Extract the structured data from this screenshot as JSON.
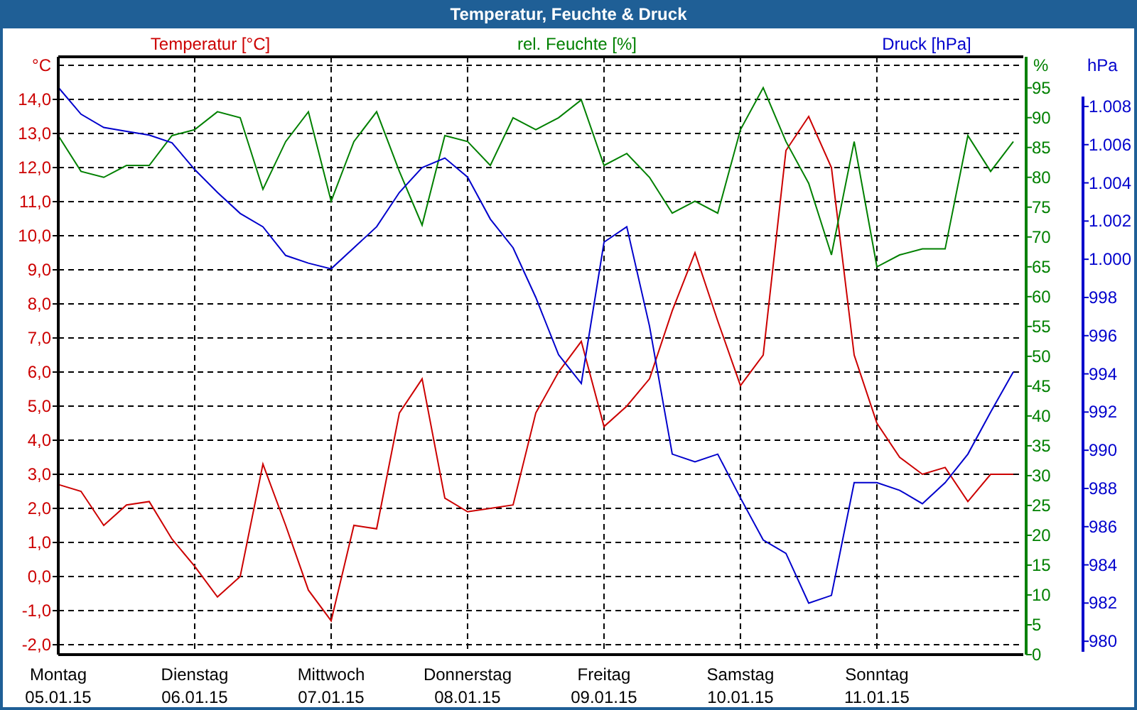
{
  "window": {
    "title": "Temperatur, Feuchte & Druck"
  },
  "chart": {
    "chart_data": {
      "type": "line",
      "grid": true,
      "categories": [
        "Montag 05.01.15",
        null,
        null,
        null,
        null,
        null,
        "Dienstag 06.01.15",
        null,
        null,
        null,
        null,
        null,
        "Mittwoch 07.01.15",
        null,
        null,
        null,
        null,
        null,
        "Donnerstag 08.01.15",
        null,
        null,
        null,
        null,
        null,
        "Freitag 09.01.15",
        null,
        null,
        null,
        null,
        null,
        "Samstag 10.01.15",
        null,
        null,
        null,
        null,
        null,
        "Sonntag 11.01.15",
        null,
        null,
        null,
        null,
        null,
        null
      ],
      "ylabel": "°C",
      "ylim": [
        -2.29,
        15.25
      ],
      "yticks": [
        {
          "value": -2,
          "label": "-2,0"
        },
        {
          "value": -1,
          "label": "-1,0"
        },
        {
          "value": 0,
          "label": "0,0"
        },
        {
          "value": 1,
          "label": "1,0"
        },
        {
          "value": 2,
          "label": "2,0"
        },
        {
          "value": 3,
          "label": "3,0"
        },
        {
          "value": 4,
          "label": "4,0"
        },
        {
          "value": 5,
          "label": "5,0"
        },
        {
          "value": 6,
          "label": "6,0"
        },
        {
          "value": 7,
          "label": "7,0"
        },
        {
          "value": 8,
          "label": "8,0"
        },
        {
          "value": 9,
          "label": "9,0"
        },
        {
          "value": 10,
          "label": "10,0"
        },
        {
          "value": 11,
          "label": "11,0"
        },
        {
          "value": 12,
          "label": "12,0"
        },
        {
          "value": 13,
          "label": "13,0"
        },
        {
          "value": 14,
          "label": "14,0"
        }
      ],
      "y2label": "%",
      "y2lim": [
        0,
        100.2
      ],
      "y2ticks": [
        {
          "value": 0,
          "label": "0"
        },
        {
          "value": 5,
          "label": "5"
        },
        {
          "value": 10,
          "label": "10"
        },
        {
          "value": 15,
          "label": "15"
        },
        {
          "value": 20,
          "label": "20"
        },
        {
          "value": 25,
          "label": "25"
        },
        {
          "value": 30,
          "label": "30"
        },
        {
          "value": 35,
          "label": "35"
        },
        {
          "value": 40,
          "label": "40"
        },
        {
          "value": 45,
          "label": "45"
        },
        {
          "value": 50,
          "label": "50"
        },
        {
          "value": 55,
          "label": "55"
        },
        {
          "value": 60,
          "label": "60"
        },
        {
          "value": 65,
          "label": "65"
        },
        {
          "value": 70,
          "label": "70"
        },
        {
          "value": 75,
          "label": "75"
        },
        {
          "value": 80,
          "label": "80"
        },
        {
          "value": 85,
          "label": "85"
        },
        {
          "value": 90,
          "label": "90"
        },
        {
          "value": 95,
          "label": "95"
        }
      ],
      "y3label": "hPa",
      "y3lim": [
        979.3,
        1010.6
      ],
      "y3ticks": [
        {
          "value": 980,
          "label": "980"
        },
        {
          "value": 982,
          "label": "982"
        },
        {
          "value": 984,
          "label": "984"
        },
        {
          "value": 986,
          "label": "986"
        },
        {
          "value": 988,
          "label": "988"
        },
        {
          "value": 990,
          "label": "990"
        },
        {
          "value": 992,
          "label": "992"
        },
        {
          "value": 994,
          "label": "994"
        },
        {
          "value": 996,
          "label": "996"
        },
        {
          "value": 998,
          "label": "998"
        },
        {
          "value": 1000,
          "label": "1.000"
        },
        {
          "value": 1002,
          "label": "1.002"
        },
        {
          "value": 1004,
          "label": "1.004"
        },
        {
          "value": 1006,
          "label": "1.006"
        },
        {
          "value": 1008,
          "label": "1.008"
        }
      ],
      "series": [
        {
          "name": "Temperatur [°C]",
          "color": "#cc0000",
          "values": [
            2.7,
            2.5,
            1.5,
            2.1,
            2.2,
            1.1,
            0.3,
            -0.6,
            0.0,
            3.3,
            1.5,
            -0.4,
            -1.3,
            1.5,
            1.4,
            4.8,
            5.8,
            2.3,
            1.9,
            2.0,
            2.1,
            4.8,
            6.0,
            6.9,
            4.4,
            5.0,
            5.8,
            7.8,
            9.5,
            7.5,
            5.6,
            6.5,
            12.5,
            13.5,
            12.0,
            6.5,
            4.5,
            3.5,
            3.0,
            3.2,
            2.2,
            3.0,
            3.0
          ]
        },
        {
          "name": "rel. Feuchte [%]",
          "color": "#008000",
          "axis": "y2",
          "values": [
            87,
            81,
            80,
            82,
            82,
            87,
            88,
            91,
            90,
            78,
            86,
            91,
            76,
            86,
            91,
            81,
            72,
            87,
            86,
            82,
            90,
            88,
            90,
            93,
            82,
            84,
            80,
            74,
            76,
            74,
            88,
            95,
            86,
            79,
            67,
            86,
            65,
            67,
            68,
            68,
            87,
            81,
            86
          ]
        },
        {
          "name": "Druck [hPa]",
          "color": "#0000cc",
          "axis": "y3",
          "values": [
            1009.0,
            1007.6,
            1006.9,
            1006.7,
            1006.5,
            1006.1,
            1004.7,
            1003.5,
            1002.4,
            1001.7,
            1000.2,
            999.8,
            999.5,
            1000.6,
            1001.7,
            1003.5,
            1004.8,
            1005.3,
            1004.3,
            1002.1,
            1000.6,
            998.0,
            995.0,
            993.5,
            1000.9,
            1001.7,
            996.5,
            989.8,
            989.4,
            989.8,
            987.5,
            985.3,
            984.6,
            982.0,
            982.4,
            988.3,
            988.3,
            987.9,
            987.2,
            988.3,
            989.8,
            992.0,
            994.1
          ]
        }
      ]
    }
  }
}
